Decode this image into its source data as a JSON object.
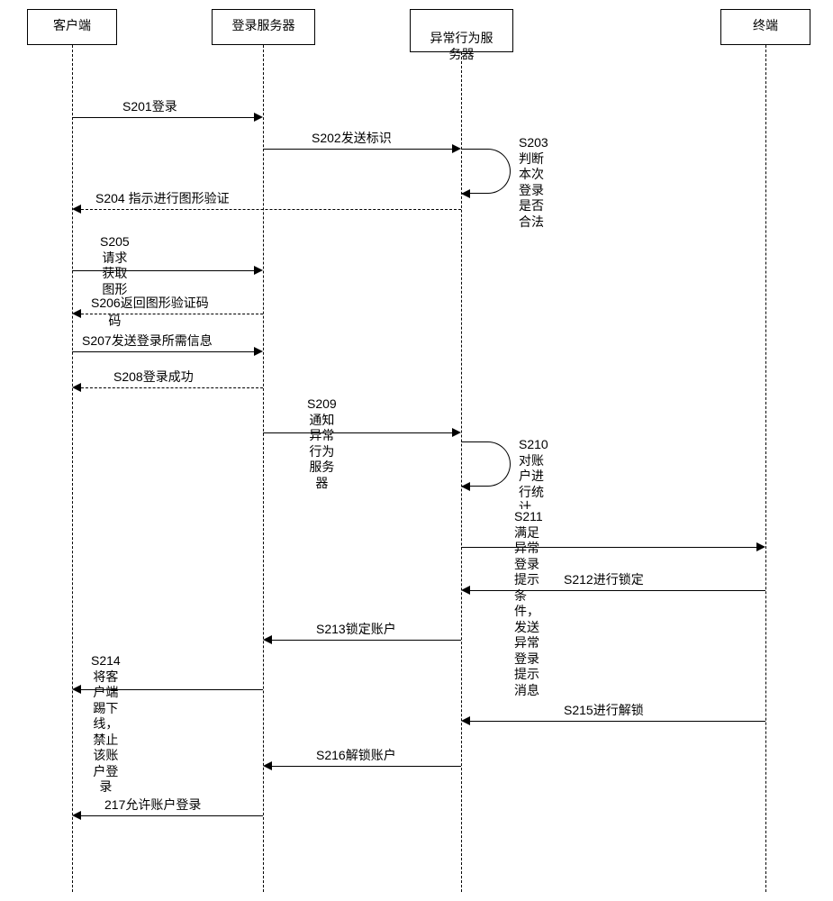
{
  "participants": {
    "client": "客户端",
    "login_server": "登录服务器",
    "abnormal_server": "异常行为服\n务器",
    "terminal": "终端"
  },
  "messages": {
    "s201": "S201登录",
    "s202": "S202发送标识",
    "s203": "S203判断本次\n登录是否合法",
    "s204": "S204 指示进行图形验证",
    "s205": "S205请求获取\n图形验证码",
    "s206": "S206返回图形验证码",
    "s207": "S207发送登录所需信息",
    "s208": "S208登录成功",
    "s209": "S209通知异常\n行为服务器",
    "s210": "S210对账户进\n行统计",
    "s211": "S211满足异常登录提示条\n件，发送异常登录提示消息",
    "s212": "S212进行锁定",
    "s213": "S213锁定账户",
    "s214": "S214将客户端踢下\n线，禁止该账户登录",
    "s215": "S215进行解锁",
    "s216": "S216解锁账户",
    "s217": "217允许账户登录"
  }
}
